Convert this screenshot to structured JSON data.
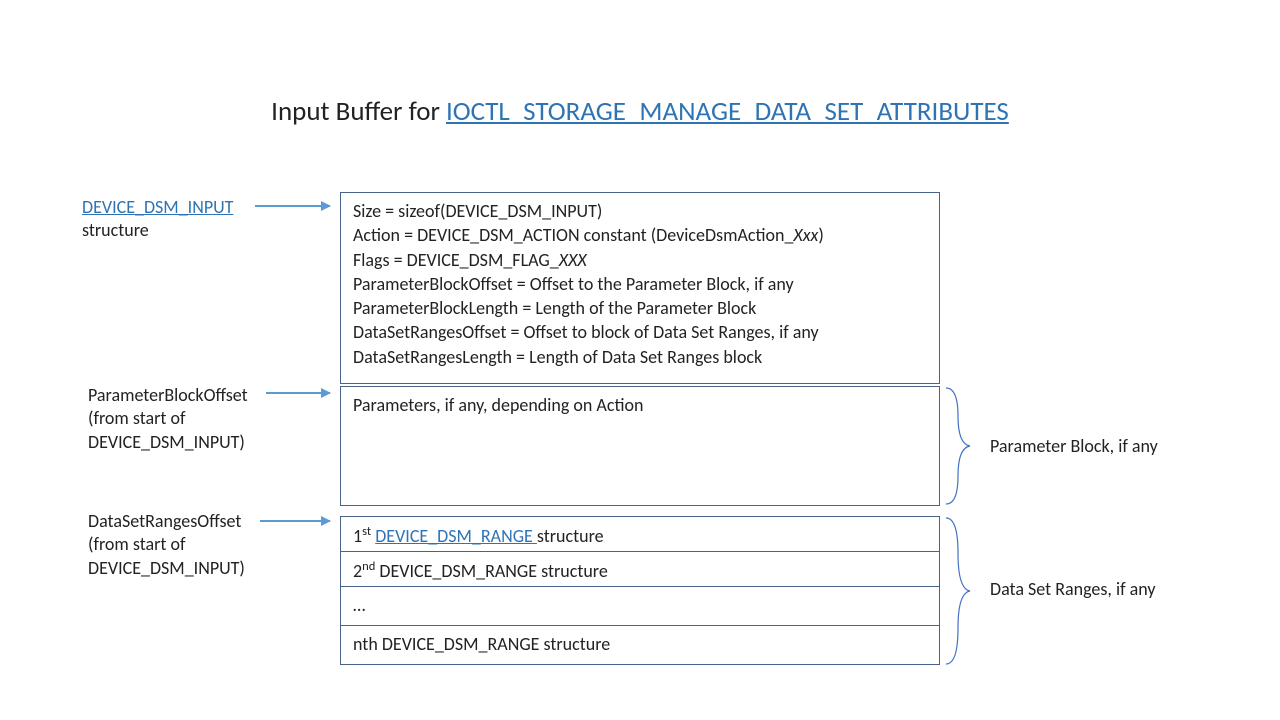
{
  "title": {
    "prefix": "Input Buffer for ",
    "link": "IOCTL_STORAGE_MANAGE_DATA_SET_ATTRIBUTES"
  },
  "leftLabels": {
    "structLink": "DEVICE_DSM_INPUT",
    "structSuffix": "structure",
    "paramOffset1": "ParameterBlockOffset",
    "paramOffset2": "(from start of",
    "paramOffset3": "DEVICE_DSM_INPUT)",
    "rangesOffset1": "DataSetRangesOffset",
    "rangesOffset2": "(from start of",
    "rangesOffset3": "DEVICE_DSM_INPUT)"
  },
  "box1": {
    "l1a": "Size  = sizeof(DEVICE_DSM_INPUT)",
    "l2a": "Action = DEVICE_DSM_ACTION  constant (DeviceDsmAction_",
    "l2b": "Xxx",
    "l2c": ")",
    "l3a": "Flags = DEVICE_DSM_FLAG_",
    "l3b": "XXX",
    "l4": "ParameterBlockOffset  = Offset to the Parameter Block, if any",
    "l5": "ParameterBlockLength = Length of the Parameter Block",
    "l6": "DataSetRangesOffset  = Offset to block of Data Set Ranges, if any",
    "l7": "DataSetRangesLength = Length of Data Set Ranges block"
  },
  "box2": {
    "text": "Parameters, if any, depending on Action"
  },
  "ranges": {
    "r1pre": "1",
    "r1sup": "st",
    "r1link": "DEVICE_DSM_RANGE ",
    "r1post": "structure",
    "r2pre": "2",
    "r2sup": "nd",
    "r2post": " DEVICE_DSM_RANGE  structure",
    "r3": "…",
    "r4": "nth DEVICE_DSM_RANGE  structure"
  },
  "rightLabels": {
    "param": "Parameter Block, if any",
    "ranges": "Data Set Ranges, if any"
  }
}
